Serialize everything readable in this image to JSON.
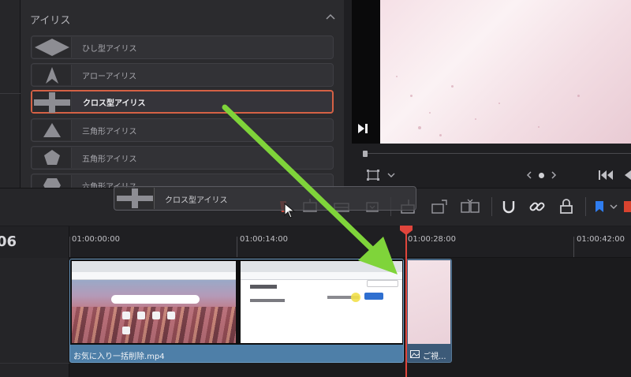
{
  "panel": {
    "section_title": "アイリス",
    "items": [
      {
        "label": "ひし型アイリス",
        "icon": "diamond-iris-icon"
      },
      {
        "label": "アローアイリス",
        "icon": "arrow-iris-icon"
      },
      {
        "label": "クロス型アイリス",
        "icon": "cross-iris-icon",
        "selected": true
      },
      {
        "label": "三角形アイリス",
        "icon": "triangle-iris-icon"
      },
      {
        "label": "五角形アイリス",
        "icon": "pentagon-iris-icon"
      },
      {
        "label": "六角形アイリス",
        "icon": "hexagon-iris-icon"
      }
    ]
  },
  "drag_ghost": {
    "label": "クロス型アイリス",
    "icon": "cross-iris-icon"
  },
  "timeline": {
    "timecode_partial": "06",
    "ruler": [
      "01:00:00:00",
      "01:00:14:00",
      "01:00:28:00",
      "01:00:42:00"
    ],
    "clips": [
      {
        "name": "お気に入り一括削除.mp4",
        "icon": "video-clip"
      },
      {
        "name": "ご視...",
        "icon": "image-icon"
      }
    ]
  },
  "colors": {
    "selected_border": "#d56145",
    "playhead": "#e0453c",
    "video_clip": "#4e7fa8",
    "annotation_arrow": "#7fd43a"
  }
}
